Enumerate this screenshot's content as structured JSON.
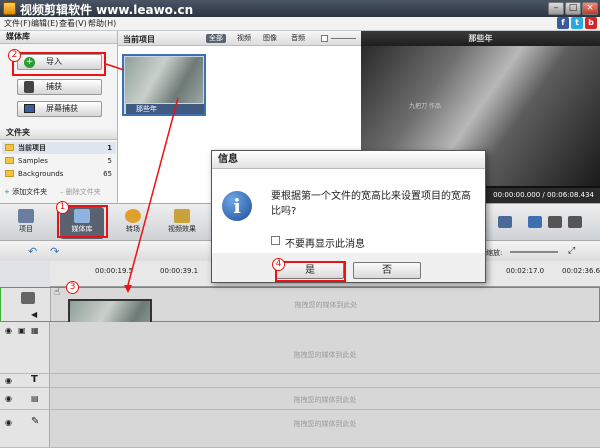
{
  "window": {
    "title": "视频剪辑软件 www.leawo.cn",
    "minimize": "–",
    "maximize": "□",
    "close": "×"
  },
  "menu": [
    "文件(F)",
    "编辑(E)",
    "查看(V)",
    "帮助(H)"
  ],
  "social": [
    {
      "label": "f",
      "color": "#3b5998"
    },
    {
      "label": "t",
      "color": "#29a9e0"
    },
    {
      "label": "b",
      "color": "#d6262b"
    }
  ],
  "left": {
    "library_title": "媒体库",
    "import": "导入",
    "capture": "捕获",
    "screen_capture": "屏幕捕获",
    "folders_title": "文件夹",
    "folders": [
      {
        "name": "当前项目",
        "count": "1"
      },
      {
        "name": "Samples",
        "count": "5"
      },
      {
        "name": "Backgrounds",
        "count": "65"
      }
    ],
    "add_folder": "添加文件夹",
    "delete_folder": "删除文件夹"
  },
  "media": {
    "title": "当前项目",
    "filters": [
      "全部",
      "视频",
      "图像",
      "音频"
    ],
    "clip_name": "那些年"
  },
  "preview": {
    "title": "那些年",
    "time": "00:00:00.000 / 00:06:08.434",
    "subtitle": "九把刀 作品"
  },
  "toolbar": {
    "items": [
      "项目",
      "媒体库",
      "转场",
      "视频效果"
    ]
  },
  "timeline": {
    "ticks": [
      "00:00:19.5",
      "00:00:39.1",
      "00:02:17.0",
      "00:02:36.6"
    ],
    "zoom_label": "缩放:",
    "drop_text": "拖拽您的媒体到此处"
  },
  "dialog": {
    "title": "信息",
    "message": "要根据第一个文件的宽高比来设置项目的宽高比吗?",
    "checkbox": "不要再显示此消息",
    "yes": "是",
    "no": "否"
  },
  "annotations": [
    "1",
    "2",
    "3",
    "4"
  ]
}
